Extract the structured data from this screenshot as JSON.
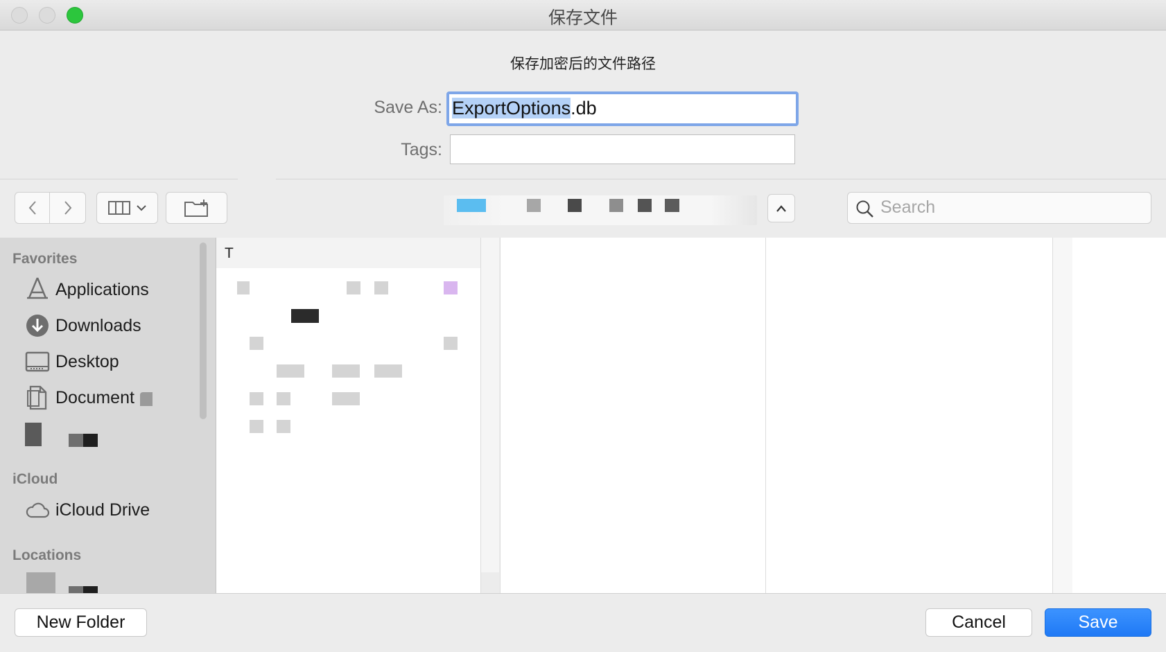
{
  "window": {
    "title": "保存文件"
  },
  "dialog": {
    "subtitle": "保存加密后的文件路径",
    "save_as": {
      "label": "Save As:",
      "value_selected": "ExportOptions",
      "value_ext": ".db"
    },
    "tags": {
      "label": "Tags:",
      "value": ""
    }
  },
  "toolbar": {
    "back_icon": "chevron-left-icon",
    "forward_icon": "chevron-right-icon",
    "view_icon": "columns-view-icon",
    "new_folder_icon": "new-folder-icon",
    "collapse_icon": "chevron-up-icon",
    "search": {
      "placeholder": "Search"
    }
  },
  "sidebar": {
    "favorites_header": "Favorites",
    "items": [
      {
        "label": "Applications",
        "icon": "applications-icon"
      },
      {
        "label": "Downloads",
        "icon": "downloads-icon"
      },
      {
        "label": "Desktop",
        "icon": "desktop-icon"
      },
      {
        "label": "Document",
        "icon": "documents-icon"
      }
    ],
    "icloud_header": "iCloud",
    "icloud_item": {
      "label": "iCloud Drive",
      "icon": "cloud-icon"
    },
    "locations_header": "Locations"
  },
  "browser": {
    "column_header": "T"
  },
  "buttons": {
    "new_folder": "New Folder",
    "cancel": "Cancel",
    "save": "Save"
  },
  "colors": {
    "accent": "#1f79f5",
    "focus_ring": "#7ea6e8",
    "selection": "#b4d1f7",
    "close_active": "#2cc63d"
  }
}
